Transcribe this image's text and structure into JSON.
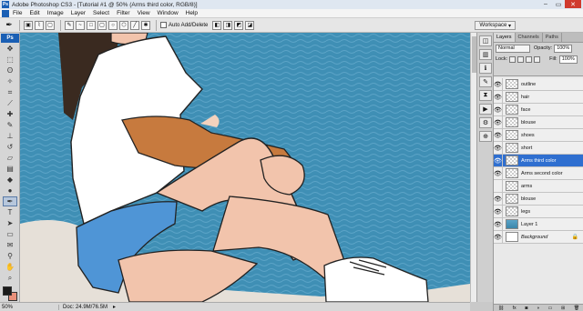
{
  "titlebar": {
    "title": "Adobe Photoshop CS3 - [Tutorial #1 @ 50% (Arms third color, RGB/8)]"
  },
  "menu": [
    "File",
    "Edit",
    "Image",
    "Layer",
    "Select",
    "Filter",
    "View",
    "Window",
    "Help"
  ],
  "options": {
    "auto_add_delete": "Auto Add/Delete",
    "workspace": "Workspace"
  },
  "toolbox": {
    "badge": "Ps",
    "foreground_color": "#1a1a1a",
    "background_color": "#e8907a"
  },
  "status": {
    "zoom": "50%",
    "doc": "Doc: 24.9M/76.5M"
  },
  "panel": {
    "tabs": [
      "Layers",
      "Channels",
      "Paths"
    ],
    "blend_mode": "Normal",
    "opacity_label": "Opacity:",
    "opacity_value": "100%",
    "lock_label": "Lock:",
    "fill_label": "Fill:",
    "fill_value": "100%"
  },
  "layers": [
    {
      "name": "outline",
      "visible": true,
      "thumb": "transparent"
    },
    {
      "name": "hair",
      "visible": true,
      "thumb": "transparent"
    },
    {
      "name": "face",
      "visible": true,
      "thumb": "transparent"
    },
    {
      "name": "blouse",
      "visible": true,
      "thumb": "transparent"
    },
    {
      "name": "shoes",
      "visible": true,
      "thumb": "transparent"
    },
    {
      "name": "short",
      "visible": true,
      "thumb": "transparent"
    },
    {
      "name": "Arms third color",
      "visible": true,
      "thumb": "transparent",
      "selected": true
    },
    {
      "name": "Arms second color",
      "visible": true,
      "thumb": "transparent"
    },
    {
      "name": "arms",
      "visible": false,
      "thumb": "transparent"
    },
    {
      "name": "blouse",
      "visible": true,
      "thumb": "transparent"
    },
    {
      "name": "legs",
      "visible": true,
      "thumb": "transparent"
    },
    {
      "name": "Layer 1",
      "visible": true,
      "thumb": "photo"
    },
    {
      "name": "Background",
      "visible": true,
      "thumb": "white",
      "locked": true
    }
  ],
  "colors": {
    "sea": "#3f8fb5",
    "skin": "#f2c4ac",
    "tan": "#c77a3e",
    "shorts": "#4f95d6",
    "selection": "#2f6fd0"
  }
}
